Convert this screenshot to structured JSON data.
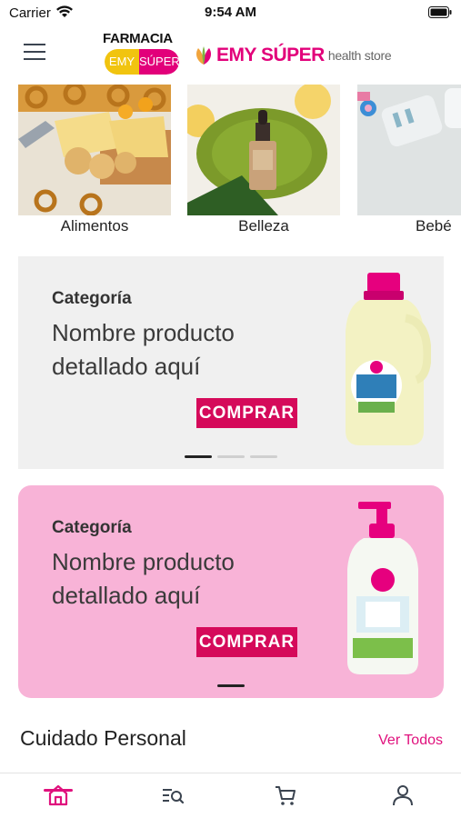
{
  "status": {
    "carrier": "Carrier",
    "time": "9:54 AM"
  },
  "header": {
    "logo_farmacia": {
      "word": "FARMACIA",
      "left": "EMY",
      "right": "SÚPER"
    },
    "logo_emy": {
      "brand": "EMY SÚPER",
      "sub": "health store"
    }
  },
  "categories": [
    {
      "label": "Alimentos"
    },
    {
      "label": "Belleza"
    },
    {
      "label": "Bebé"
    }
  ],
  "banners": [
    {
      "category": "Categoría",
      "name": "Nombre producto detallado aquí",
      "button": "COMPRAR"
    },
    {
      "category": "Categoría",
      "name": "Nombre producto detallado aquí",
      "button": "COMPRAR"
    }
  ],
  "section": {
    "title": "Cuidado Personal",
    "see_all": "Ver Todos"
  },
  "tabs": [
    {
      "icon": "home-icon"
    },
    {
      "icon": "search-list-icon"
    },
    {
      "icon": "cart-icon"
    },
    {
      "icon": "user-icon"
    }
  ],
  "colors": {
    "accent": "#e0117d",
    "button": "#d50a5a",
    "banner_pink": "#f8b3d7",
    "banner_gray": "#f0f0f0"
  }
}
